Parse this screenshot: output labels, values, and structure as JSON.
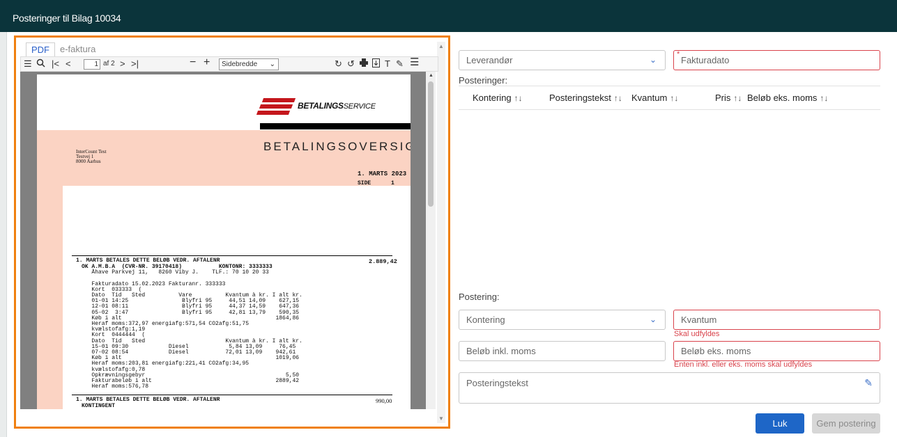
{
  "window": {
    "title": "Posteringer til Bilag 10034"
  },
  "viewer": {
    "tabs": [
      {
        "label": "PDF",
        "active": true
      },
      {
        "label": "e-faktura",
        "active": false
      }
    ],
    "toolbar": {
      "page_current": "1",
      "page_of": "af 2",
      "zoom": "Sidebredde",
      "icons": [
        "sidebar-toggle-icon",
        "search-icon",
        "first-page-icon",
        "prev-page-icon",
        "next-page-icon",
        "last-page-icon",
        "zoom-out-icon",
        "zoom-in-icon",
        "rotate-cw-icon",
        "rotate-ccw-icon",
        "print-icon",
        "download-icon",
        "text-icon",
        "draw-icon",
        "menu-icon"
      ]
    },
    "document": {
      "logo_text_bold": "BETALINGS",
      "logo_text_rest": "SERVICE",
      "heading": "BETALINGSOVERSIGT",
      "address": [
        "InterCount Test",
        "Testvej 1",
        "8000 Aarhus"
      ],
      "date": "1. MARTS 2023",
      "side_label": "SIDE",
      "side_value": "1",
      "block1_title": "1. MARTS BETALES DETTE BELØB VEDR. AFTALENR",
      "block1_amount": "2.889,42",
      "block1_lines": [
        "OK A.M.B.A  (CVR-NR. 39170418)           KONTONR: 3333333",
        "   Åhave Parkvej 11,   8260 Viby J.    TLF.: 70 10 20 33",
        "",
        "   Fakturadato 15.02.2023 Fakturanr. 333333",
        "   Kort  033333  (",
        "   Dato  Tid   Sted          Vare          Kvantum à kr. I alt kr.",
        "   01-01 14:25                Blyfri 95     44,51 14,09    627,15",
        "   12-01 08:11                Blyfri 95     44,37 14,59    647,36",
        "   05-02  3:47                Blyfri 95     42,81 13,79    590,35",
        "   Køb i alt                                              1864,86",
        "   Heraf moms:372,97 energiafg:571,54 CO2afg:51,75",
        "   kvælstofafg:1,19",
        "   Kort  0444444  (",
        "   Dato  Tid   Sted                        Kvantum à kr. I alt kr.",
        "   15-01 09:30            Diesel            5,84 13,09     76,45",
        "   07-02 08:54            Diesel           72,01 13,09    942,61",
        "   Køb i alt                                              1019,06",
        "   Heraf moms:203,81 energiafg:221,41 CO2afg:34,95",
        "   kvælstofafg:0,78",
        "   Opkrævningsgebyr                                          5,50",
        "   Fakturabeløb i alt                                     2889,42",
        "   Heraf moms:576,78"
      ],
      "block2_title": "1. MARTS BETALES DETTE BELØB VEDR. AFTALENR",
      "block2_amount": "990,00",
      "block2_sub": "KONTINGENT"
    }
  },
  "form": {
    "leverandor_placeholder": "Leverandør",
    "fakturadato_placeholder": "Fakturadato",
    "posteringer_label": "Posteringer:",
    "columns": [
      {
        "label": "Kontering"
      },
      {
        "label": "Posteringstekst"
      },
      {
        "label": "Kvantum"
      },
      {
        "label": "Pris"
      },
      {
        "label": "Beløb eks. moms"
      }
    ],
    "sort_icon": "↑↓",
    "postering_label": "Postering:",
    "kontering_placeholder": "Kontering",
    "kvantum_placeholder": "Kvantum",
    "kvantum_error": "Skal udfyldes",
    "belob_inkl_placeholder": "Beløb inkl. moms",
    "belob_eks_placeholder": "Beløb eks. moms",
    "belob_error": "Enten inkl. eller eks. moms skal udfyldes",
    "posteringstekst_placeholder": "Posteringstekst",
    "buttons": {
      "close": "Luk",
      "save": "Gem postering"
    },
    "colors": {
      "error": "#d9434c",
      "primary": "#1e66c7",
      "header": "#0b343b",
      "frame": "#f0800f"
    }
  }
}
